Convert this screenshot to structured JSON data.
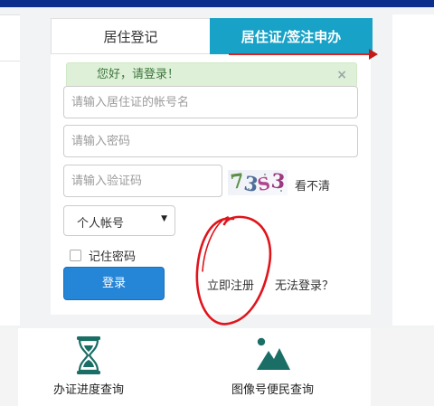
{
  "tabs": {
    "register": "居住登记",
    "apply": "居住证/签注申办"
  },
  "greeting": {
    "text": "您好，请登录！",
    "close": "×"
  },
  "form": {
    "account_placeholder": "请输入居住证的帐号名",
    "password_placeholder": "请输入密码",
    "captcha_placeholder": "请输入验证码",
    "captcha_chars": [
      "7",
      "3",
      "S",
      "3"
    ],
    "captcha_refresh": "看不清",
    "account_type": "个人帐号",
    "remember": "记住密码",
    "login": "登录",
    "register_link": "立即注册",
    "cant_login": "无法登录？"
  },
  "services": [
    {
      "label": "办证进度查询",
      "icon": "hourglass-icon"
    },
    {
      "label": "图像号便民查询",
      "icon": "mountain-image-icon"
    }
  ],
  "colors": {
    "tab_active": "#18a2c7",
    "primary_button": "#2585d7",
    "alert_bg": "#dff0d8",
    "icon_teal": "#1a6e66",
    "annotation_red": "#e0141b"
  }
}
